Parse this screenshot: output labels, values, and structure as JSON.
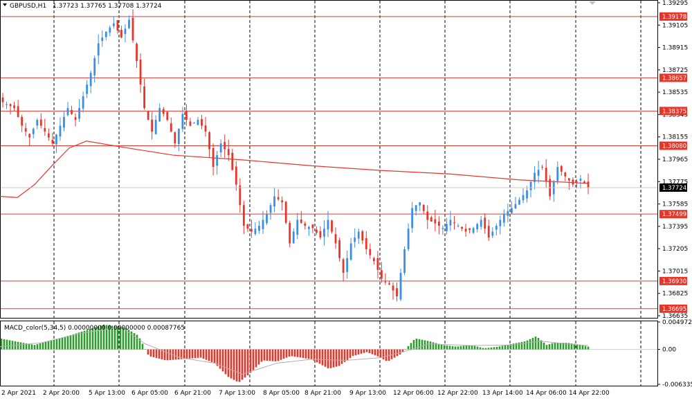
{
  "header": {
    "symbol": "GBPUSD,H1",
    "ohlc": "1.37723 1.37765 1.37708 1.37724"
  },
  "macd": {
    "title": "MACD_color(5,34,5) 0.00000000 0.00000000 0.00087765",
    "ticks": [
      "0.0049727",
      "0.00",
      "-0.006335"
    ],
    "ylim": [
      -0.006335,
      0.0049727
    ]
  },
  "colors": {
    "bull": "#3a8ee6",
    "bear": "#e8352a",
    "level": "#e8352a",
    "ma": "#e8352a",
    "grid": "#000000",
    "macd_pos": "#2e9b2e",
    "macd_neg": "#e8352a",
    "signal": "#b0b0b0",
    "current": "#000000"
  },
  "chart_data": {
    "type": "candlestick",
    "symbol": "GBPUSD",
    "timeframe": "H1",
    "ylim": [
      1.36635,
      1.39295
    ],
    "y_ticks": [
      "1.39295",
      "1.39105",
      "1.38915",
      "1.38725",
      "1.38535",
      "1.38345",
      "1.38155",
      "1.37965",
      "1.37775",
      "1.37585",
      "1.37395",
      "1.37205",
      "1.37015",
      "1.36825",
      "1.36635"
    ],
    "x_ticks": [
      "2 Apr 2021",
      "2 Apr 20:00",
      "5 Apr 13:00",
      "6 Apr 05:00",
      "6 Apr 21:00",
      "7 Apr 13:00",
      "8 Apr 05:00",
      "8 Apr 21:00",
      "9 Apr 13:00",
      "12 Apr 06:00",
      "12 Apr 22:00",
      "13 Apr 14:00",
      "14 Apr 06:00",
      "14 Apr 22:00"
    ],
    "levels": [
      "1.39178",
      "1.38657",
      "1.38375",
      "1.38080",
      "1.37499",
      "1.36930",
      "1.36695"
    ],
    "current_price": "1.37724",
    "close_path": [
      [
        0,
        1.3845
      ],
      [
        3,
        1.384
      ],
      [
        5,
        1.3825
      ],
      [
        7,
        1.3815
      ],
      [
        9,
        1.383
      ],
      [
        11,
        1.382
      ],
      [
        13,
        1.381
      ],
      [
        15,
        1.3825
      ],
      [
        17,
        1.384
      ],
      [
        19,
        1.383
      ],
      [
        21,
        1.385
      ],
      [
        23,
        1.387
      ],
      [
        25,
        1.3895
      ],
      [
        27,
        1.3905
      ],
      [
        29,
        1.3912
      ],
      [
        31,
        1.39
      ],
      [
        33,
        1.3915
      ],
      [
        35,
        1.388
      ],
      [
        37,
        1.384
      ],
      [
        39,
        1.382
      ],
      [
        41,
        1.384
      ],
      [
        43,
        1.383
      ],
      [
        45,
        1.381
      ],
      [
        47,
        1.3835
      ],
      [
        49,
        1.3825
      ],
      [
        51,
        1.383
      ],
      [
        53,
        1.382
      ],
      [
        55,
        1.379
      ],
      [
        57,
        1.381
      ],
      [
        59,
        1.38
      ],
      [
        61,
        1.3775
      ],
      [
        63,
        1.374
      ],
      [
        65,
        1.3735
      ],
      [
        67,
        1.374
      ],
      [
        69,
        1.375
      ],
      [
        71,
        1.3765
      ],
      [
        73,
        1.376
      ],
      [
        75,
        1.3725
      ],
      [
        77,
        1.3745
      ],
      [
        79,
        1.374
      ],
      [
        81,
        1.3738
      ],
      [
        83,
        1.373
      ],
      [
        85,
        1.3745
      ],
      [
        87,
        1.3725
      ],
      [
        89,
        1.37
      ],
      [
        91,
        1.3725
      ],
      [
        93,
        1.3735
      ],
      [
        95,
        1.372
      ],
      [
        97,
        1.371
      ],
      [
        99,
        1.3695
      ],
      [
        101,
        1.369
      ],
      [
        103,
        1.368
      ],
      [
        105,
        1.372
      ],
      [
        107,
        1.3755
      ],
      [
        109,
        1.376
      ],
      [
        111,
        1.3745
      ],
      [
        113,
        1.3742
      ],
      [
        115,
        1.3738
      ],
      [
        117,
        1.3745
      ],
      [
        119,
        1.374
      ],
      [
        121,
        1.3735
      ],
      [
        123,
        1.3738
      ],
      [
        125,
        1.3745
      ],
      [
        127,
        1.373
      ],
      [
        129,
        1.374
      ],
      [
        131,
        1.375
      ],
      [
        133,
        1.3755
      ],
      [
        135,
        1.3762
      ],
      [
        137,
        1.377
      ],
      [
        139,
        1.3785
      ],
      [
        141,
        1.379
      ],
      [
        143,
        1.3765
      ],
      [
        145,
        1.379
      ],
      [
        147,
        1.3782
      ],
      [
        149,
        1.3775
      ],
      [
        151,
        1.378
      ],
      [
        153,
        1.3772
      ]
    ],
    "ma": [
      [
        0,
        1.3765
      ],
      [
        25,
        1.3764
      ],
      [
        50,
        1.3775
      ],
      [
        75,
        1.3791
      ],
      [
        100,
        1.3806
      ],
      [
        125,
        1.3812
      ],
      [
        175,
        1.3807
      ],
      [
        250,
        1.38
      ],
      [
        350,
        1.3796
      ],
      [
        450,
        1.3791
      ],
      [
        550,
        1.3787
      ],
      [
        650,
        1.3784
      ],
      [
        750,
        1.3779
      ],
      [
        850,
        1.3776
      ]
    ],
    "macd_hist": [
      [
        0,
        0.002
      ],
      [
        50,
        0.0008
      ],
      [
        100,
        0.0025
      ],
      [
        150,
        0.0045
      ],
      [
        180,
        0.004
      ],
      [
        200,
        0.0025
      ],
      [
        215,
        -0.0012
      ],
      [
        240,
        -0.002
      ],
      [
        260,
        -0.0018
      ],
      [
        290,
        -0.0015
      ],
      [
        310,
        -0.0025
      ],
      [
        330,
        -0.005
      ],
      [
        345,
        -0.006
      ],
      [
        360,
        -0.0045
      ],
      [
        380,
        -0.002
      ],
      [
        400,
        -0.0022
      ],
      [
        420,
        -0.0012
      ],
      [
        450,
        -0.0018
      ],
      [
        475,
        -0.0035
      ],
      [
        490,
        -0.003
      ],
      [
        510,
        -0.0012
      ],
      [
        530,
        -0.0005
      ],
      [
        545,
        -0.0012
      ],
      [
        560,
        -0.0022
      ],
      [
        580,
        -0.0008
      ],
      [
        600,
        0.002
      ],
      [
        620,
        0.0015
      ],
      [
        640,
        0.0008
      ],
      [
        660,
        0.0005
      ],
      [
        680,
        0.0008
      ],
      [
        700,
        0.0002
      ],
      [
        720,
        0.0005
      ],
      [
        740,
        0.001
      ],
      [
        760,
        0.0015
      ],
      [
        775,
        0.0024
      ],
      [
        790,
        0.0008
      ],
      [
        800,
        0.0012
      ],
      [
        820,
        0.0012
      ],
      [
        840,
        0.0008
      ],
      [
        850,
        0.0005
      ]
    ],
    "macd_signal": [
      [
        0,
        0.0005
      ],
      [
        60,
        0.0012
      ],
      [
        120,
        0.003
      ],
      [
        175,
        0.004
      ],
      [
        210,
        0.001
      ],
      [
        260,
        -0.0015
      ],
      [
        310,
        -0.0025
      ],
      [
        350,
        -0.0045
      ],
      [
        400,
        -0.0025
      ],
      [
        450,
        -0.0018
      ],
      [
        500,
        -0.002
      ],
      [
        550,
        -0.0015
      ],
      [
        590,
        -0.0002
      ],
      [
        620,
        0.001
      ],
      [
        680,
        0.0007
      ],
      [
        740,
        0.0008
      ],
      [
        780,
        0.0015
      ],
      [
        820,
        0.001
      ],
      [
        850,
        0.0007
      ]
    ]
  }
}
